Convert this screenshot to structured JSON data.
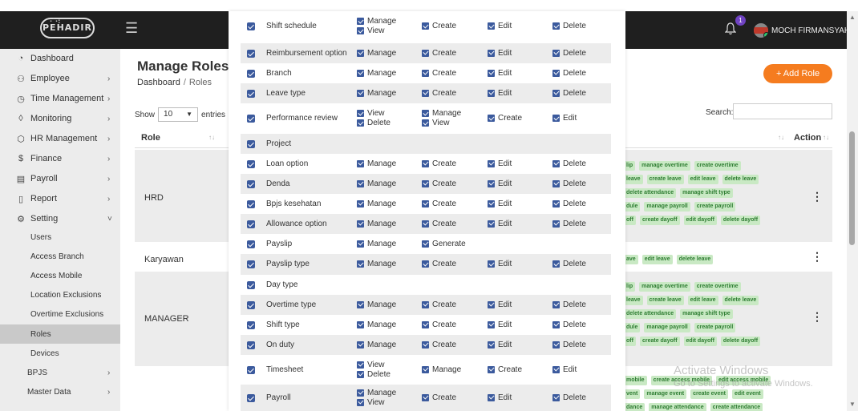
{
  "header": {
    "logo": "PEHADIR",
    "notification_count": "1",
    "username": "MOCH FIRMANSYAH"
  },
  "sidebar": {
    "items": [
      {
        "label": "Dashboard",
        "icon": "dashboard-icon"
      },
      {
        "label": "Employee",
        "icon": "users-icon"
      },
      {
        "label": "Time Management",
        "icon": "clock-icon"
      },
      {
        "label": "Monitoring",
        "icon": "location-icon"
      },
      {
        "label": "HR Management",
        "icon": "box-icon"
      },
      {
        "label": "Finance",
        "icon": "dollar-icon"
      },
      {
        "label": "Payroll",
        "icon": "payroll-icon"
      },
      {
        "label": "Report",
        "icon": "file-icon"
      },
      {
        "label": "Setting",
        "icon": "gear-icon"
      }
    ],
    "setting_sub": [
      "Users",
      "Access Branch",
      "Access Mobile",
      "Location Exclusions",
      "Overtime Exclusions",
      "Roles",
      "Devices"
    ],
    "after": [
      "BPJS",
      "Master Data"
    ]
  },
  "main": {
    "title": "Manage Roles",
    "breadcrumb_root": "Dashboard",
    "breadcrumb_sep": "/",
    "breadcrumb_current": "Roles",
    "add_button": "+ Add Role",
    "show_label": "Show",
    "show_value": "10",
    "entries_label": "entries",
    "search_label": "Search:",
    "col_role": "Role",
    "col_action": "Action",
    "roles": [
      {
        "name": "HRD",
        "perm_lines": [
          [
            "lip",
            "manage overtime",
            "create overtime"
          ],
          [
            "leave",
            "create leave",
            "edit leave",
            "delete leave"
          ],
          [
            "delete attendance",
            "manage shift type"
          ],
          [
            "dule",
            "manage payroll",
            "create payroll"
          ],
          [
            "off",
            "create dayoff",
            "edit dayoff",
            "delete dayoff"
          ]
        ]
      },
      {
        "name": "Karyawan",
        "perm_lines": [
          [
            "ave",
            "edit leave",
            "delete leave"
          ]
        ]
      },
      {
        "name": "MANAGER",
        "perm_lines": [
          [
            "lip",
            "manage overtime",
            "create overtime"
          ],
          [
            "leave",
            "create leave",
            "edit leave",
            "delete leave"
          ],
          [
            "delete attendance",
            "manage shift type"
          ],
          [
            "dule",
            "manage payroll",
            "create payroll"
          ],
          [
            "off",
            "create dayoff",
            "edit dayoff",
            "delete dayoff"
          ]
        ]
      },
      {
        "name": "",
        "perm_lines": [
          [
            "mobile",
            "create access mobile",
            "edit access mobile"
          ],
          [
            "vent",
            "manage event",
            "create event",
            "edit event"
          ],
          [
            "dance",
            "manage attendance",
            "create attendance"
          ]
        ]
      }
    ]
  },
  "watermark": {
    "line1": "Activate Windows",
    "line2": "Go to Settings to activate Windows."
  },
  "permissions": [
    {
      "name": "Shift schedule",
      "options": [
        [
          "Manage",
          "View"
        ],
        [
          "Create"
        ],
        [
          "Edit"
        ],
        [
          "Delete"
        ]
      ]
    },
    {
      "name": "Reimbursement option",
      "options": [
        [
          "Manage"
        ],
        [
          "Create"
        ],
        [
          "Edit"
        ],
        [
          "Delete"
        ]
      ]
    },
    {
      "name": "Branch",
      "options": [
        [
          "Manage"
        ],
        [
          "Create"
        ],
        [
          "Edit"
        ],
        [
          "Delete"
        ]
      ]
    },
    {
      "name": "Leave type",
      "options": [
        [
          "Manage"
        ],
        [
          "Create"
        ],
        [
          "Edit"
        ],
        [
          "Delete"
        ]
      ]
    },
    {
      "name": "Performance review",
      "options": [
        [
          "View",
          "Delete"
        ],
        [
          "Manage",
          "View"
        ],
        [
          "Create"
        ],
        [
          "Edit"
        ]
      ]
    },
    {
      "name": "Project",
      "options": []
    },
    {
      "name": "Loan option",
      "options": [
        [
          "Manage"
        ],
        [
          "Create"
        ],
        [
          "Edit"
        ],
        [
          "Delete"
        ]
      ]
    },
    {
      "name": "Denda",
      "options": [
        [
          "Manage"
        ],
        [
          "Create"
        ],
        [
          "Edit"
        ],
        [
          "Delete"
        ]
      ]
    },
    {
      "name": "Bpjs kesehatan",
      "options": [
        [
          "Manage"
        ],
        [
          "Create"
        ],
        [
          "Edit"
        ],
        [
          "Delete"
        ]
      ]
    },
    {
      "name": "Allowance option",
      "options": [
        [
          "Manage"
        ],
        [
          "Create"
        ],
        [
          "Edit"
        ],
        [
          "Delete"
        ]
      ]
    },
    {
      "name": "Payslip",
      "options": [
        [
          "Manage"
        ],
        [
          "Generate"
        ]
      ]
    },
    {
      "name": "Payslip type",
      "options": [
        [
          "Manage"
        ],
        [
          "Create"
        ],
        [
          "Edit"
        ],
        [
          "Delete"
        ]
      ]
    },
    {
      "name": "Day type",
      "options": []
    },
    {
      "name": "Overtime type",
      "options": [
        [
          "Manage"
        ],
        [
          "Create"
        ],
        [
          "Edit"
        ],
        [
          "Delete"
        ]
      ]
    },
    {
      "name": "Shift type",
      "options": [
        [
          "Manage"
        ],
        [
          "Create"
        ],
        [
          "Edit"
        ],
        [
          "Delete"
        ]
      ]
    },
    {
      "name": "On duty",
      "options": [
        [
          "Manage"
        ],
        [
          "Create"
        ],
        [
          "Edit"
        ],
        [
          "Delete"
        ]
      ]
    },
    {
      "name": "Timesheet",
      "options": [
        [
          "View",
          "Delete"
        ],
        [
          "Manage"
        ],
        [
          "Create"
        ],
        [
          "Edit"
        ]
      ]
    },
    {
      "name": "Payroll",
      "options": [
        [
          "Manage",
          "View"
        ],
        [
          "Create"
        ],
        [
          "Edit"
        ],
        [
          "Delete"
        ]
      ]
    }
  ],
  "colors": {
    "accent": "#f57c1f",
    "checkbox": "#3b5a9d",
    "chip_bg": "#c9e9c4",
    "chip_text": "#2e7d32",
    "topbar": "#1f1f1f"
  }
}
